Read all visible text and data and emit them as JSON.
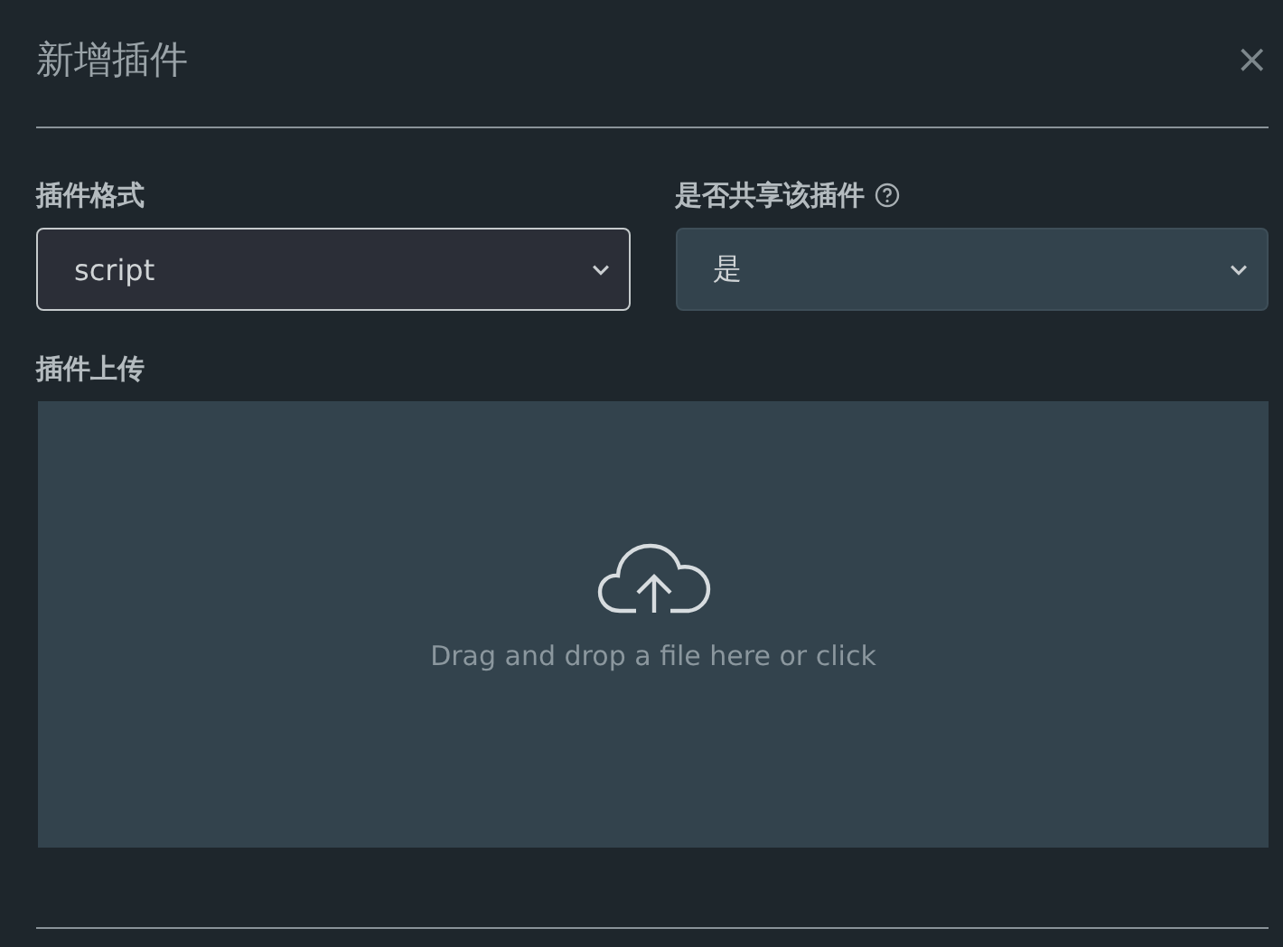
{
  "dialog": {
    "title": "新增插件",
    "close": "×",
    "format": {
      "label": "插件格式",
      "value": "script"
    },
    "share": {
      "label": "是否共享该插件",
      "value": "是"
    },
    "upload": {
      "label": "插件上传",
      "hint": "Drag and drop a file here or click"
    }
  }
}
